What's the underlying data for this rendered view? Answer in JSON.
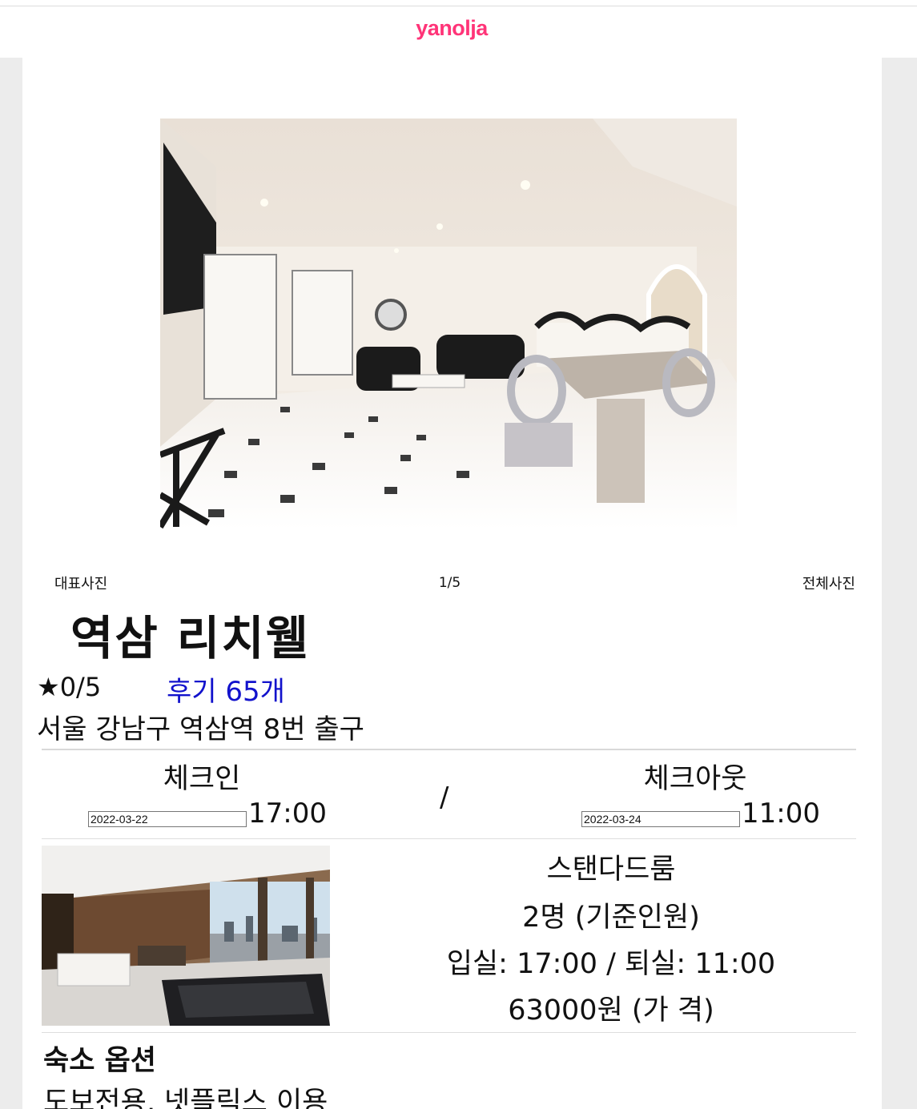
{
  "brand": {
    "logo": "yanolja",
    "color": "#ff3478"
  },
  "gallery": {
    "left_label": "대표사진",
    "counter": "1/5",
    "right_label": "전체사진"
  },
  "hotel": {
    "name": "역삼 리치웰",
    "rating": "★0/5",
    "reviews": "후기 65개",
    "address": "서울 강남구 역삼역 8번 출구"
  },
  "stay": {
    "checkin_label": "체크인",
    "checkin_date": "2022-03-22",
    "checkin_time": "17:00",
    "separator": "/",
    "checkout_label": "체크아웃",
    "checkout_date": "2022-03-24",
    "checkout_time": "11:00"
  },
  "room": {
    "name": "스탠다드룸",
    "capacity": "2명 (기준인원)",
    "hours": "입실: 17:00 / 퇴실: 11:00",
    "price": "63000원 (가 격)"
  },
  "options": {
    "title": "숙소 옵션",
    "value": "도보전용, 넷플릭스 이용"
  }
}
